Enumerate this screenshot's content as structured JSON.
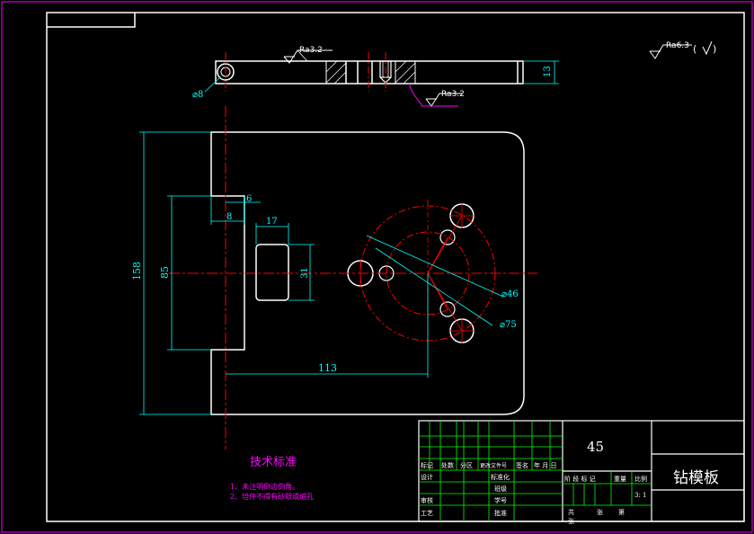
{
  "colors": {
    "background": "#000000",
    "outline": "#ffffff",
    "dimension": "#00ffff",
    "centerline": "#ff0000",
    "titleblock": "#00ff00",
    "notes": "#ff00ff",
    "frame": "#ff00ff"
  },
  "top_view": {
    "roughness_top": "Ra3.2",
    "roughness_bottom": "Ra3.2",
    "hole_dia": "⌀8",
    "thickness": "13"
  },
  "general_roughness": {
    "value": "Ra6.3",
    "paren_open": "(",
    "paren_close": ")"
  },
  "dims": {
    "height_158": "158",
    "height_85": "85",
    "width_8": "8",
    "width_6": "6",
    "width_17": "17",
    "height_31": "31",
    "length_113": "113",
    "dia_46": "⌀46",
    "dia_75": "⌀75"
  },
  "notes": {
    "title": "技术标准",
    "line1": "1、未注明倒边倒角。",
    "line2": "2、培件不得有砂眼或缩孔"
  },
  "title_block": {
    "material": "45",
    "part_name": "钻模板",
    "h_biaoji": "标记",
    "h_chushu": "处数",
    "h_fenqu": "分区",
    "h_gengwj": "更改文件号",
    "h_qianming": "签名",
    "h_date": "年 月 日",
    "r_sheji": "设计",
    "r_biaozhunhua": "标准化",
    "r_banben": "班级",
    "r_shenhe": "审核",
    "r_xuehao": "学号",
    "r_gongyi": "工艺",
    "r_pizhun": "批准",
    "stage_label": "阶 段 标 记",
    "weight_label": "重量",
    "scale_label": "比例",
    "scale_value": "3: 1",
    "sheet_total": "共",
    "sheet_zhang": "张",
    "sheet_di": "第",
    "sheet_zhang2": "张"
  }
}
